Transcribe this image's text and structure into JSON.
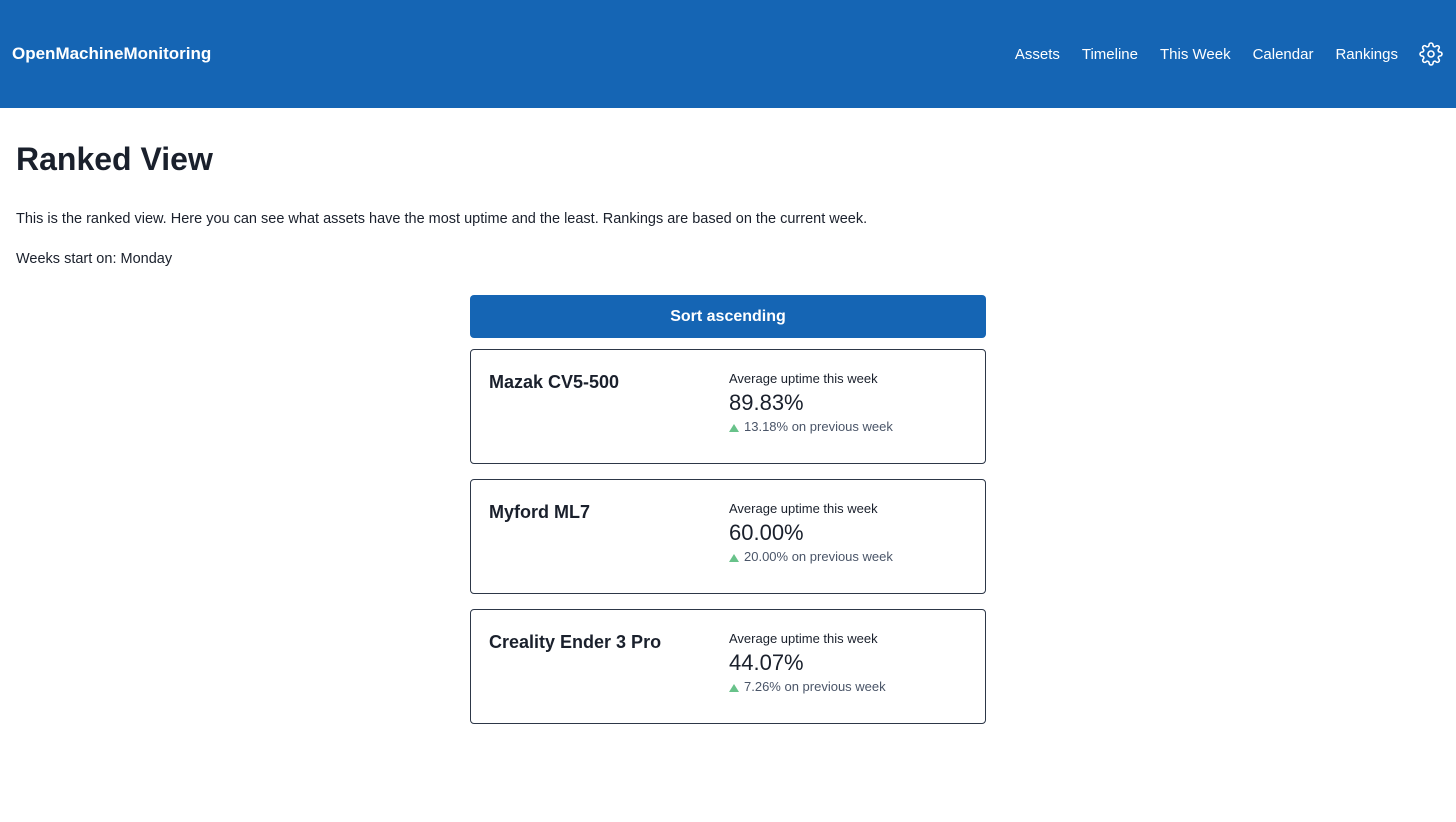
{
  "nav": {
    "brand": "OpenMachineMonitoring",
    "links": [
      "Assets",
      "Timeline",
      "This Week",
      "Calendar",
      "Rankings"
    ],
    "settings_icon": "gear-icon",
    "background": "#1565b4"
  },
  "page": {
    "title": "Ranked View",
    "description": "This is the ranked view. Here you can see what assets have the most uptime and the least. Rankings are based on the current week.",
    "week_start": "Weeks start on: Monday"
  },
  "ranking": {
    "sort_label": "Sort ascending",
    "assets": [
      {
        "name": "Mazak CV5-500",
        "label": "Average uptime this week",
        "value": "89.83%",
        "change": "13.18% on previous week",
        "trend": "up"
      },
      {
        "name": "Myford ML7",
        "label": "Average uptime this week",
        "value": "60.00%",
        "change": "20.00% on previous week",
        "trend": "up"
      },
      {
        "name": "Creality Ender 3 Pro",
        "label": "Average uptime this week",
        "value": "44.07%",
        "change": "7.26% on previous week",
        "trend": "up"
      }
    ]
  },
  "colors": {
    "primary": "#1565b4",
    "trend_up": "#68c28a"
  }
}
